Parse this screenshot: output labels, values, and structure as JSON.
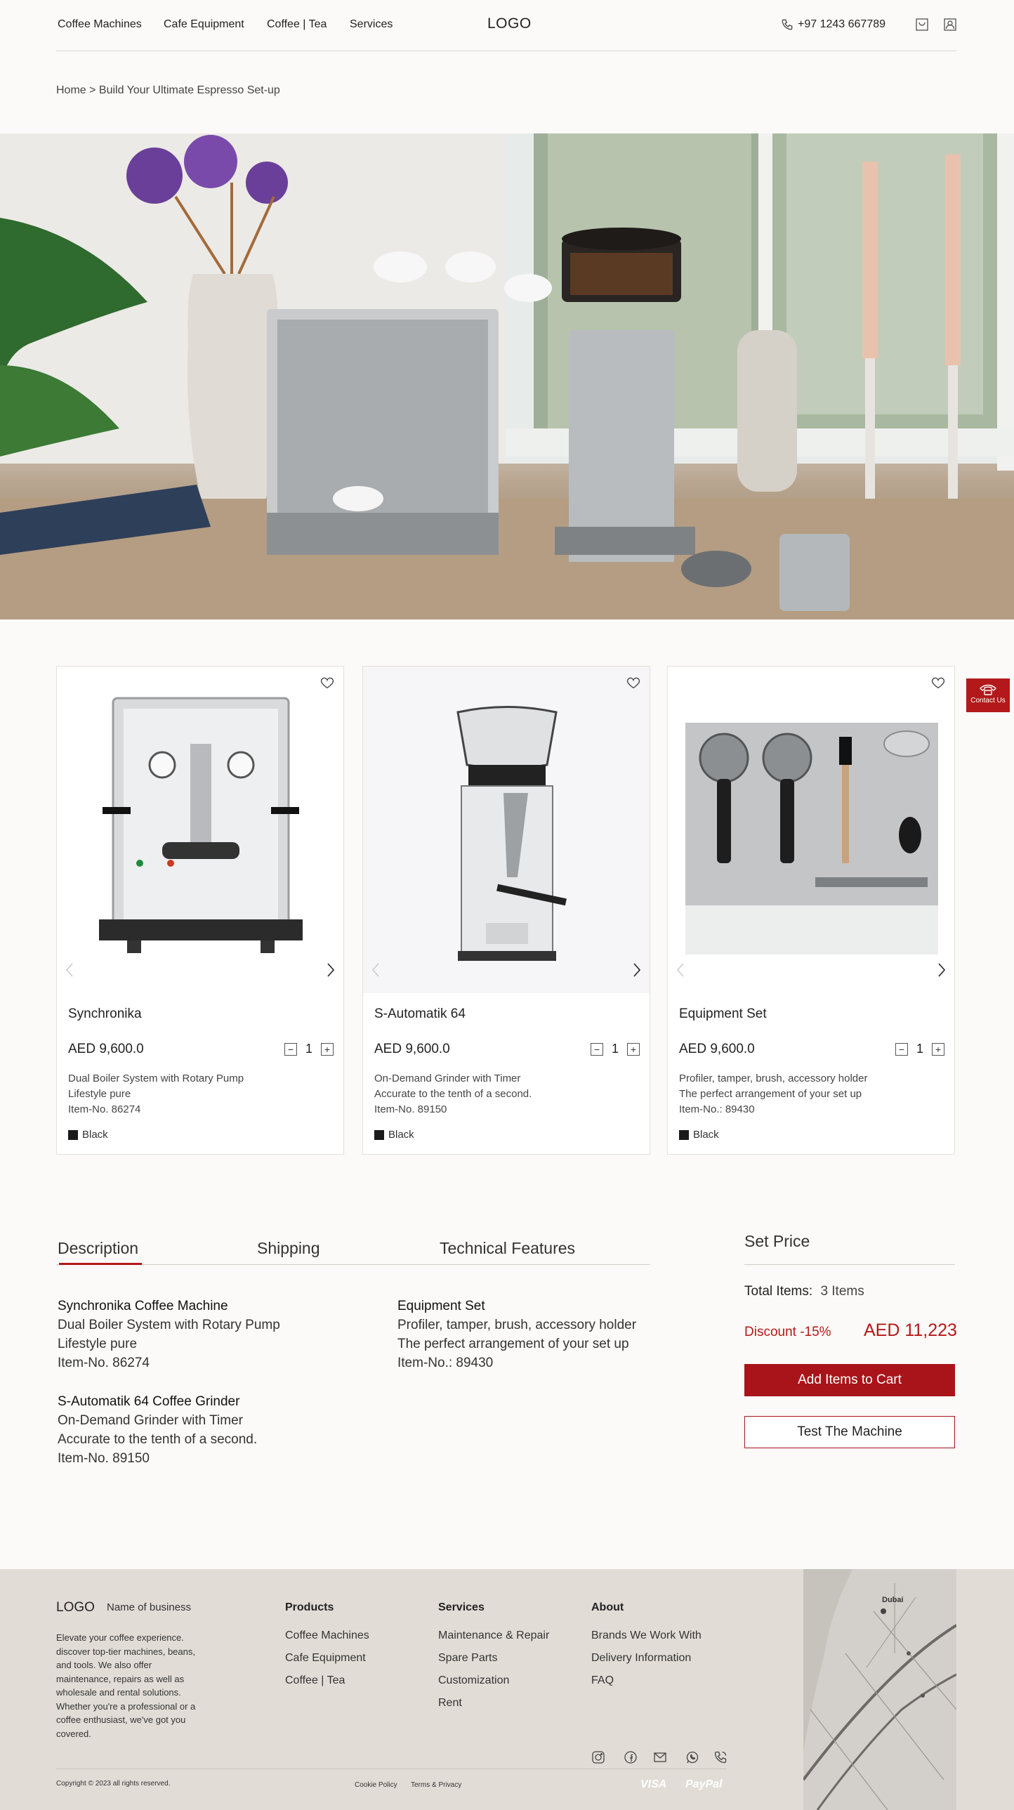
{
  "header": {
    "nav": [
      "Coffee Machines",
      "Cafe Equipment",
      "Coffee | Tea",
      "Services"
    ],
    "logo": "LOGO",
    "phone": "+97 1243 667789",
    "icons": [
      "phone-icon",
      "cart-icon",
      "user-icon"
    ]
  },
  "breadcrumb": "Home > Build Your Ultimate Espresso Set-up",
  "products": [
    {
      "name": "Synchronika",
      "price": "AED 9,600.0",
      "qty": "1",
      "desc1": "Dual Boiler System with Rotary Pump",
      "desc2": "Lifestyle pure",
      "desc3": "Item-No. 86274",
      "color": "Black"
    },
    {
      "name": "S-Automatik 64",
      "price": "AED 9,600.0",
      "qty": "1",
      "desc1": "On-Demand Grinder with Timer",
      "desc2": "Accurate to the tenth of a second.",
      "desc3": "Item-No. 89150",
      "color": "Black"
    },
    {
      "name": "Equipment Set",
      "price": "AED 9,600.0",
      "qty": "1",
      "desc1": "Profiler, tamper, brush, accessory holder",
      "desc2": "The perfect arrangement of your set up",
      "desc3": "Item-No.: 89430",
      "color": "Black"
    }
  ],
  "contact": "Contact Us",
  "tabs": [
    "Description",
    "Shipping",
    "Technical Features"
  ],
  "active_tab": "Description",
  "description": {
    "synchronika": {
      "title": "Synchronika Coffee Machine",
      "l1": "Dual Boiler System with Rotary Pump",
      "l2": "Lifestyle pure",
      "l3": "Item-No. 86274"
    },
    "grinder": {
      "title": "S-Automatik 64 Coffee Grinder",
      "l1": "On-Demand Grinder with Timer",
      "l2": "Accurate to the tenth of a second.",
      "l3": "Item-No. 89150"
    },
    "equipment": {
      "title": "Equipment Set",
      "l1": "Profiler, tamper, brush, accessory holder",
      "l2": "The perfect arrangement of your set up",
      "l3": "Item-No.: 89430"
    }
  },
  "set_price": {
    "title": "Set Price",
    "total_label": "Total Items:",
    "total_value": "3 Items",
    "discount": "Discount -15%",
    "price": "AED 11,223",
    "add_to_cart": "Add Items to Cart",
    "test": "Test The Machine"
  },
  "footer": {
    "logo": "LOGO",
    "business": "Name of business",
    "about": "Elevate your coffee experience. discover top-tier machines, beans, and tools. We also offer maintenance, repairs as well as wholesale and rental solutions. Whether you're a professional or a coffee enthusiast, we've got you covered.",
    "products_h": "Products",
    "products": [
      "Coffee Machines",
      "Cafe Equipment",
      "Coffee | Tea"
    ],
    "services_h": "Services",
    "services": [
      "Maintenance & Repair",
      "Spare Parts",
      "Customization",
      "Rent"
    ],
    "about_h": "About",
    "about_links": [
      "Brands We Work With",
      "Delivery Information",
      "FAQ"
    ],
    "copyright": "Copyright © 2023 all rights reserved.",
    "cookie": "Cookie Policy",
    "terms": "Terms & Privacy",
    "pay1": "VISA",
    "pay2": "PayPal",
    "map_label": "Dubai"
  },
  "colors": {
    "accent": "#b3191a",
    "footer_bg": "#e1ddd6",
    "page_bg": "#fbfaf8"
  }
}
